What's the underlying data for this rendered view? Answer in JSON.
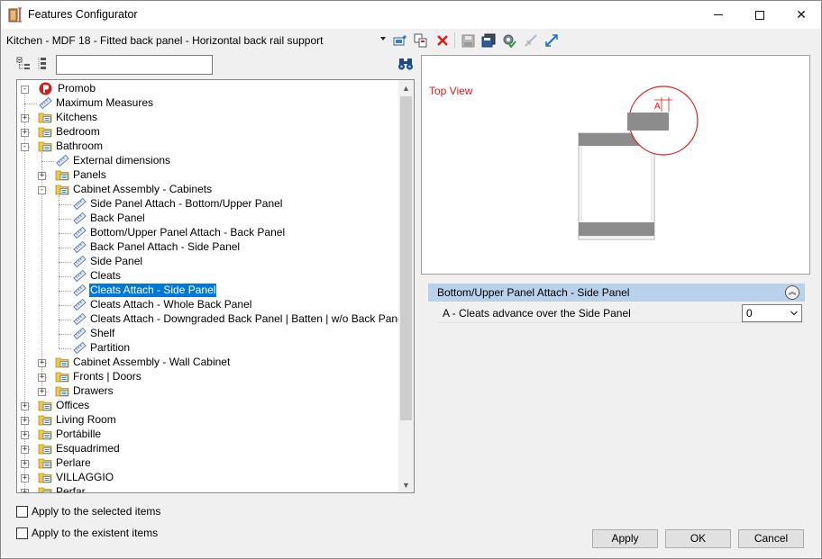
{
  "window": {
    "title": "Features Configurator",
    "minimize_label": "",
    "close_label": "✕"
  },
  "toolbar": {
    "config_selected": "Kitchen - MDF 18 - Fitted back panel - Horizontal back rail support"
  },
  "search": {
    "value": "",
    "placeholder": ""
  },
  "tree": {
    "root": "Promob",
    "items": [
      {
        "label": "Maximum Measures",
        "depth": 1,
        "expander": "",
        "icon": "item-icon"
      },
      {
        "label": "Kitchens",
        "depth": 1,
        "expander": "+",
        "icon": "folder-icon"
      },
      {
        "label": "Bedroom",
        "depth": 1,
        "expander": "+",
        "icon": "folder-icon"
      },
      {
        "label": "Bathroom",
        "depth": 1,
        "expander": "-",
        "icon": "folder-icon"
      },
      {
        "label": "External dimensions",
        "depth": 2,
        "expander": "",
        "icon": "item-icon"
      },
      {
        "label": "Panels",
        "depth": 2,
        "expander": "+",
        "icon": "folder-icon"
      },
      {
        "label": "Cabinet Assembly - Cabinets",
        "depth": 2,
        "expander": "-",
        "icon": "folder-icon"
      },
      {
        "label": "Side Panel Attach - Bottom/Upper Panel",
        "depth": 3,
        "expander": "",
        "icon": "item-icon"
      },
      {
        "label": "Back Panel",
        "depth": 3,
        "expander": "",
        "icon": "item-icon"
      },
      {
        "label": " Bottom/Upper Panel Attach - Back Panel",
        "depth": 3,
        "expander": "",
        "icon": "item-icon"
      },
      {
        "label": "Back Panel Attach - Side Panel",
        "depth": 3,
        "expander": "",
        "icon": "item-icon"
      },
      {
        "label": "Side Panel",
        "depth": 3,
        "expander": "",
        "icon": "item-icon"
      },
      {
        "label": "Cleats",
        "depth": 3,
        "expander": "",
        "icon": "item-icon"
      },
      {
        "label": "Cleats Attach - Side Panel",
        "depth": 3,
        "expander": "",
        "icon": "item-icon",
        "selected": true
      },
      {
        "label": "Cleats Attach - Whole Back Panel",
        "depth": 3,
        "expander": "",
        "icon": "item-icon"
      },
      {
        "label": "Cleats Attach - Downgraded Back Panel | Batten | w/o Back Panel",
        "depth": 3,
        "expander": "",
        "icon": "item-icon"
      },
      {
        "label": "Shelf",
        "depth": 3,
        "expander": "",
        "icon": "item-icon"
      },
      {
        "label": "Partition",
        "depth": 3,
        "expander": "",
        "icon": "item-icon"
      },
      {
        "label": "Cabinet Assembly - Wall Cabinet",
        "depth": 2,
        "expander": "+",
        "icon": "folder-icon"
      },
      {
        "label": "Fronts | Doors",
        "depth": 2,
        "expander": "+",
        "icon": "folder-icon"
      },
      {
        "label": "Drawers",
        "depth": 2,
        "expander": "+",
        "icon": "folder-icon"
      },
      {
        "label": "Offices",
        "depth": 1,
        "expander": "+",
        "icon": "folder-icon"
      },
      {
        "label": "Living Room",
        "depth": 1,
        "expander": "+",
        "icon": "folder-icon"
      },
      {
        "label": "Portábille",
        "depth": 1,
        "expander": "+",
        "icon": "folder-icon"
      },
      {
        "label": "Esquadrimed",
        "depth": 1,
        "expander": "+",
        "icon": "folder-icon"
      },
      {
        "label": "Perlare",
        "depth": 1,
        "expander": "+",
        "icon": "folder-icon"
      },
      {
        "label": "VILLAGGIO",
        "depth": 1,
        "expander": "+",
        "icon": "folder-icon"
      },
      {
        "label": "Perfar",
        "depth": 1,
        "expander": "+",
        "icon": "folder-icon"
      }
    ]
  },
  "preview": {
    "title": "Top View",
    "dimension_label": "A"
  },
  "properties": {
    "group_title": "Bottom/Upper Panel Attach - Side Panel",
    "rows": [
      {
        "label": "A - Cleats advance over the Side Panel",
        "value": "0"
      }
    ]
  },
  "options": {
    "apply_selected": "Apply to the selected items",
    "apply_existent": "Apply to the existent items"
  },
  "buttons": {
    "apply": "Apply",
    "ok": "OK",
    "cancel": "Cancel"
  },
  "colors": {
    "selection": "#0078d7",
    "group_header": "#b9d1ea",
    "drawing_accent": "#e01a1a",
    "folder": "#f5c542"
  }
}
